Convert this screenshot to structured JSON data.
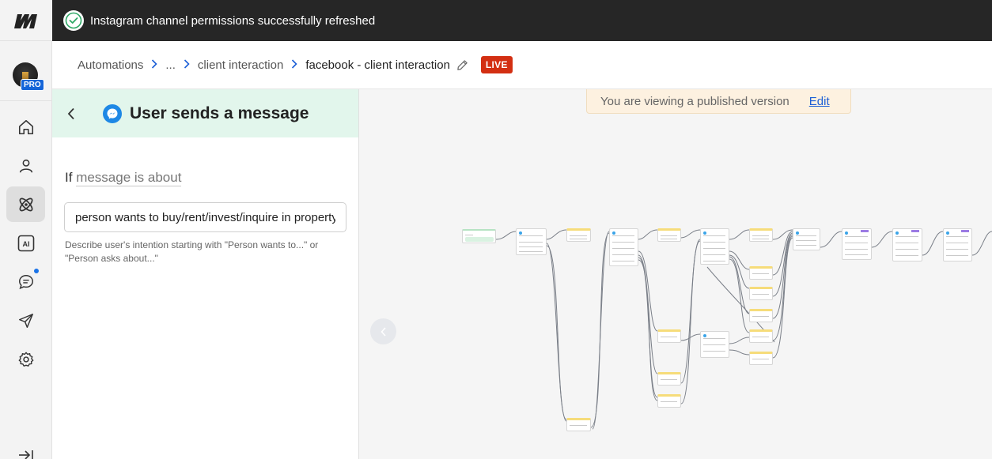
{
  "toast": {
    "message": "Instagram channel permissions successfully refreshed"
  },
  "nav": {
    "pro_badge": "PRO",
    "items": [
      {
        "name": "home-icon",
        "active": false
      },
      {
        "name": "user-icon",
        "active": false
      },
      {
        "name": "automations-icon",
        "active": true
      },
      {
        "name": "ai-icon",
        "active": false
      },
      {
        "name": "chat-icon",
        "active": false,
        "notification": true
      },
      {
        "name": "send-icon",
        "active": false
      },
      {
        "name": "settings-icon",
        "active": false
      }
    ]
  },
  "breadcrumb": {
    "items": [
      "Automations",
      "...",
      "client interaction"
    ],
    "current": "facebook - client interaction",
    "status": "LIVE"
  },
  "panel": {
    "title": "User sends a message",
    "if_label": "If",
    "condition_link": "message is about",
    "input_value": "person wants to buy/rent/invest/inquire in property",
    "hint": "Describe user's intention starting with \"Person wants to...\" or \"Person asks about...\""
  },
  "canvas": {
    "banner_text": "You are viewing a published version",
    "edit_link": "Edit"
  },
  "colors": {
    "toast_bg": "#262626",
    "panel_header_bg": "#e2f6ec",
    "live_badge": "#d32f12",
    "link": "#1d5fd6",
    "pro_badge": "#1565d8"
  }
}
